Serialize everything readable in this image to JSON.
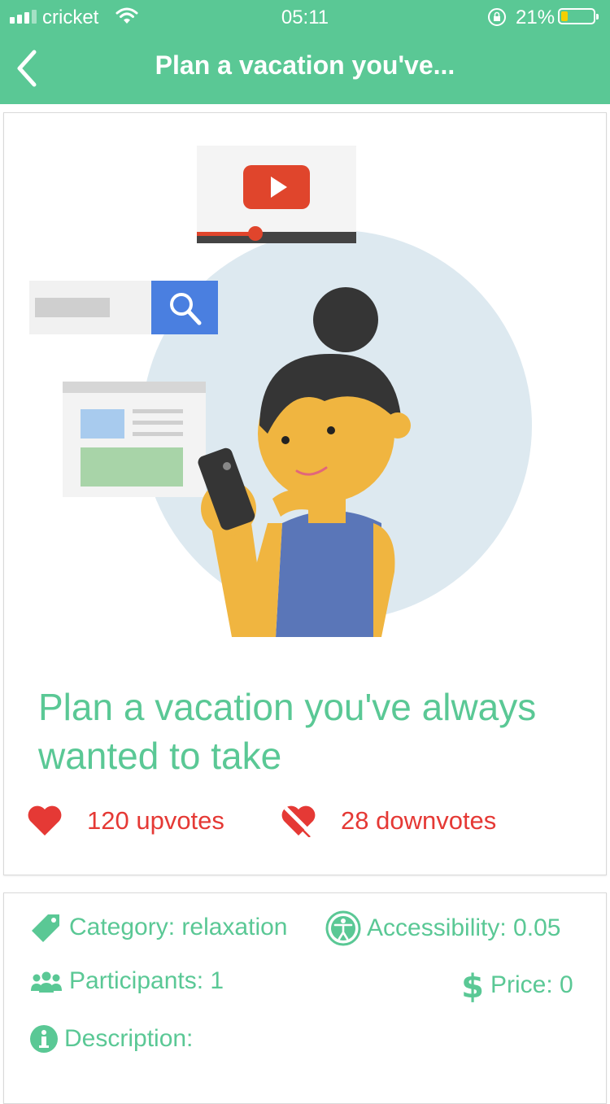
{
  "status_bar": {
    "carrier": "cricket",
    "time": "05:11",
    "battery_percent": "21%",
    "battery_level": 0.21
  },
  "nav": {
    "title": "Plan a vacation you've..."
  },
  "activity": {
    "title": "Plan a vacation you've always wanted to take",
    "upvotes": "120 upvotes",
    "downvotes": "28 downvotes"
  },
  "details": {
    "category": "Category: relaxation",
    "accessibility": "Accessibility: 0.05",
    "participants": "Participants: 1",
    "price": "Price: 0",
    "description": "Description:"
  },
  "colors": {
    "brand_green": "#5ac895",
    "vote_red": "#e53935"
  },
  "icons": [
    "back-chevron-icon",
    "heart-icon",
    "broken-heart-icon",
    "tag-icon",
    "accessibility-icon",
    "people-icon",
    "dollar-icon",
    "info-icon"
  ]
}
